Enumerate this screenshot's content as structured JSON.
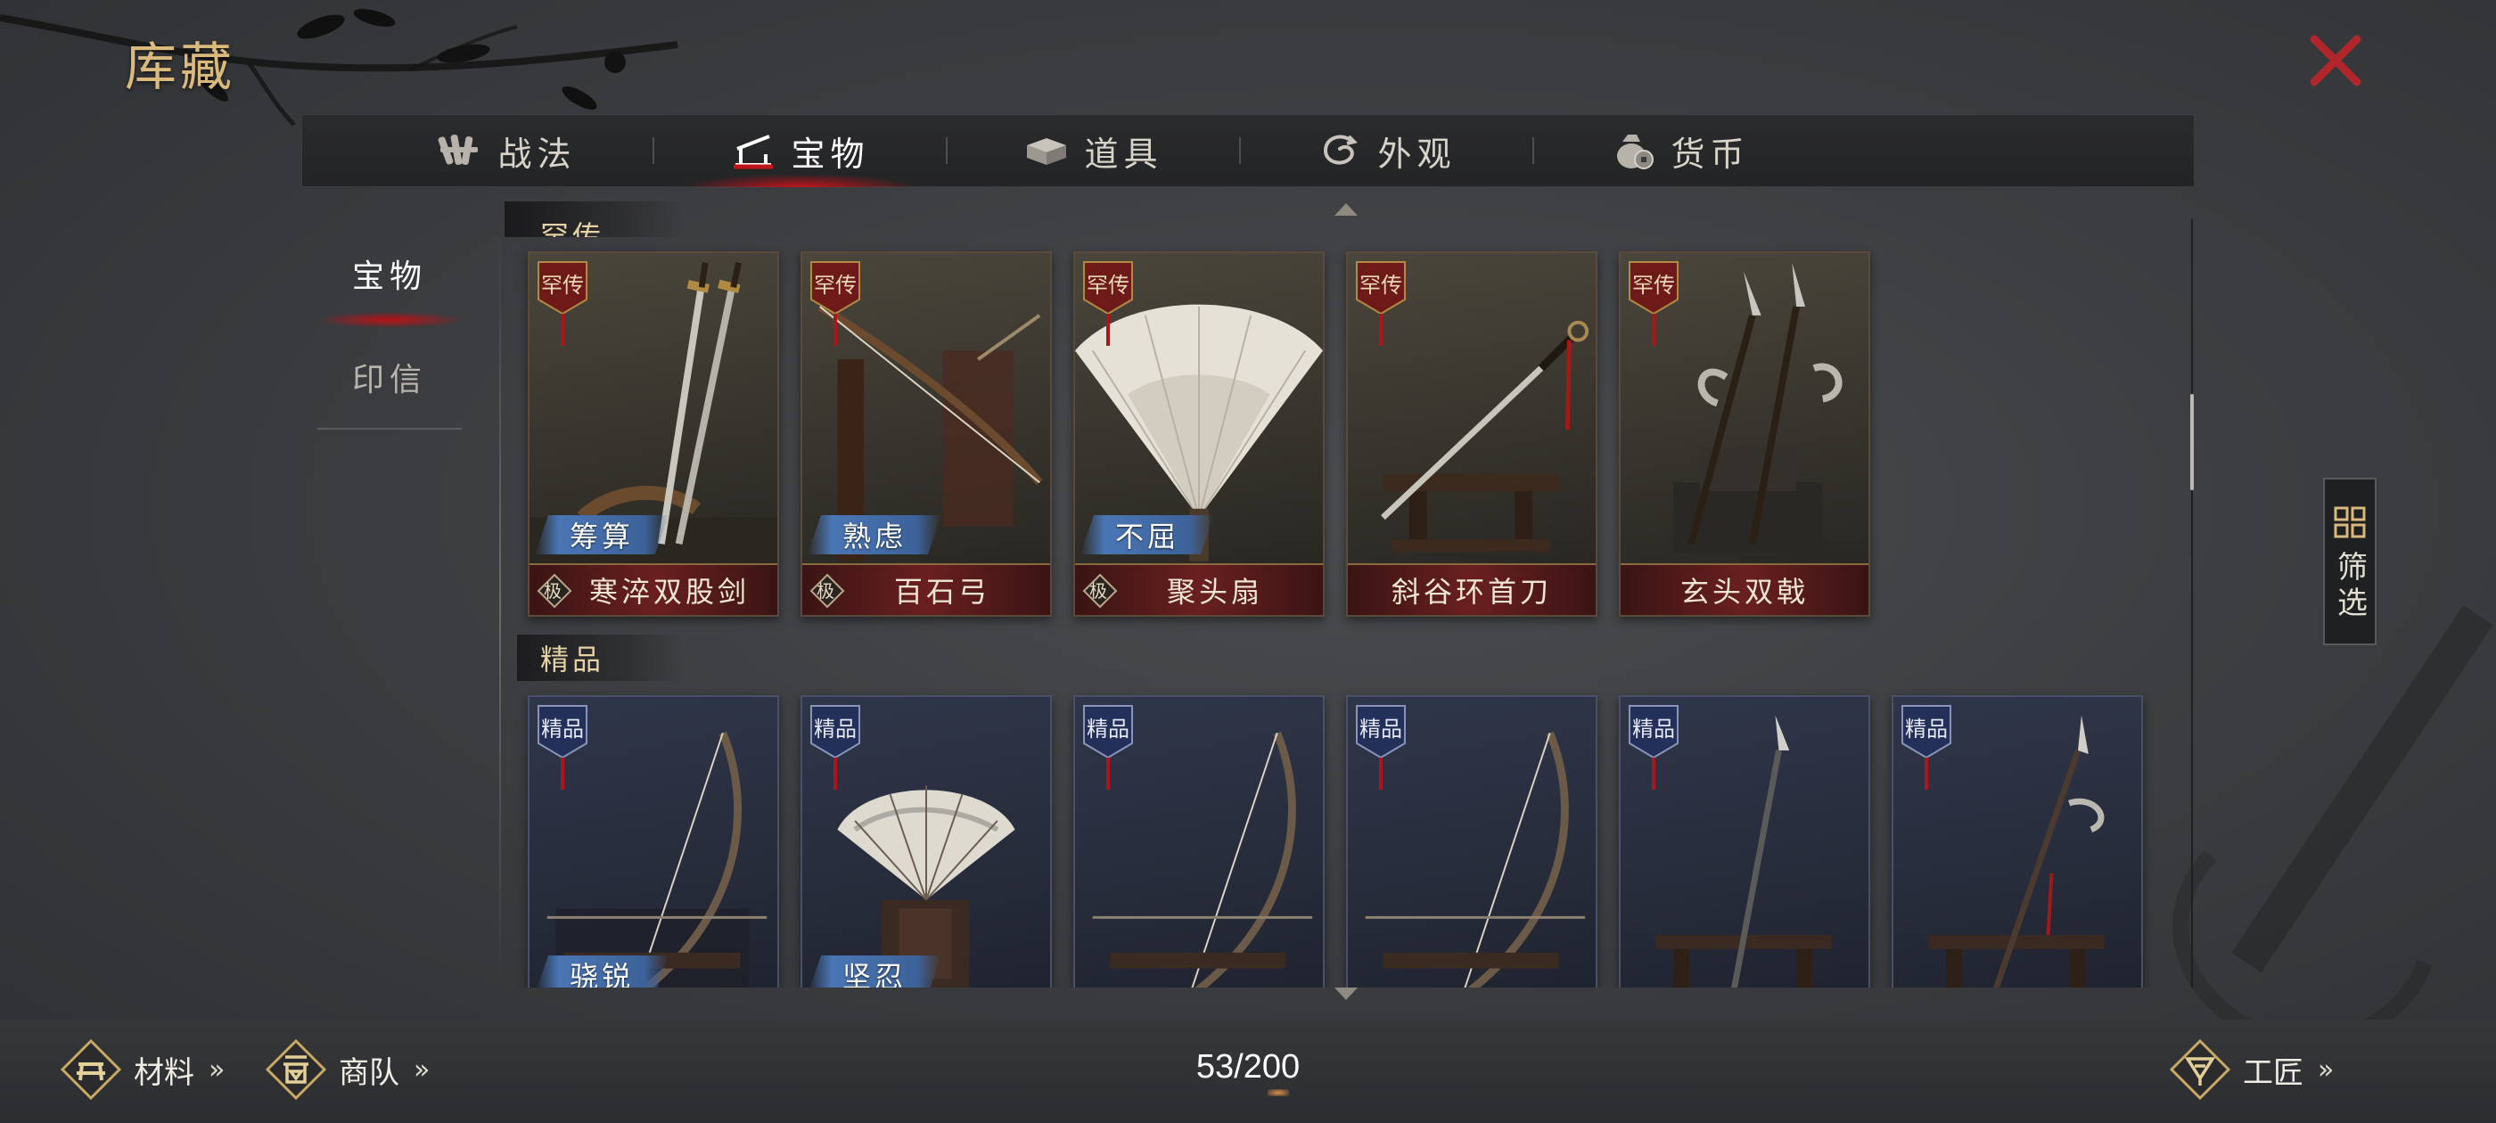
{
  "page": {
    "title": "库藏"
  },
  "tabs": [
    {
      "label": "战法",
      "icon": "scroll-bundle-icon",
      "active": false
    },
    {
      "label": "宝物",
      "icon": "treasure-stand-icon",
      "active": true
    },
    {
      "label": "道具",
      "icon": "box-icon",
      "active": false
    },
    {
      "label": "外观",
      "icon": "swirl-icon",
      "active": false
    },
    {
      "label": "货币",
      "icon": "money-bag-icon",
      "active": false
    }
  ],
  "side_menu": [
    {
      "label": "宝物",
      "active": true
    },
    {
      "label": "印信",
      "active": false
    }
  ],
  "sections": {
    "rare": {
      "label": "罕传",
      "grade_tag": "罕传"
    },
    "fine": {
      "label": "精品",
      "grade_tag": "精品"
    }
  },
  "rare_items": [
    {
      "name": "寒淬双股剑",
      "skill": "筹算",
      "grade_mark": "极",
      "art": "twin-swords"
    },
    {
      "name": "百石弓",
      "skill": "熟虑",
      "grade_mark": "极",
      "art": "bow"
    },
    {
      "name": "聚头扇",
      "skill": "不屈",
      "grade_mark": "极",
      "art": "feather-fan"
    },
    {
      "name": "斜谷环首刀",
      "skill": "",
      "grade_mark": "",
      "art": "ring-sword"
    },
    {
      "name": "玄头双戟",
      "skill": "",
      "grade_mark": "",
      "art": "twin-halberds"
    }
  ],
  "fine_items": [
    {
      "skill": "骁锐",
      "art": "bow"
    },
    {
      "skill": "坚忍",
      "art": "fan"
    },
    {
      "skill": "",
      "art": "bow"
    },
    {
      "skill": "",
      "art": "bow"
    },
    {
      "skill": "",
      "art": "spear"
    },
    {
      "skill": "",
      "art": "halberd"
    }
  ],
  "filter": {
    "label": "筛选"
  },
  "bottom": {
    "materials": "材料",
    "caravan": "商队",
    "craftsman": "工匠",
    "chevron": "»",
    "count": "53/200"
  },
  "colors": {
    "accent_red": "#c0141b",
    "gold": "#d9b97c",
    "skill_blue": "#4a76b5",
    "name_bar": "#6a1f1f"
  }
}
